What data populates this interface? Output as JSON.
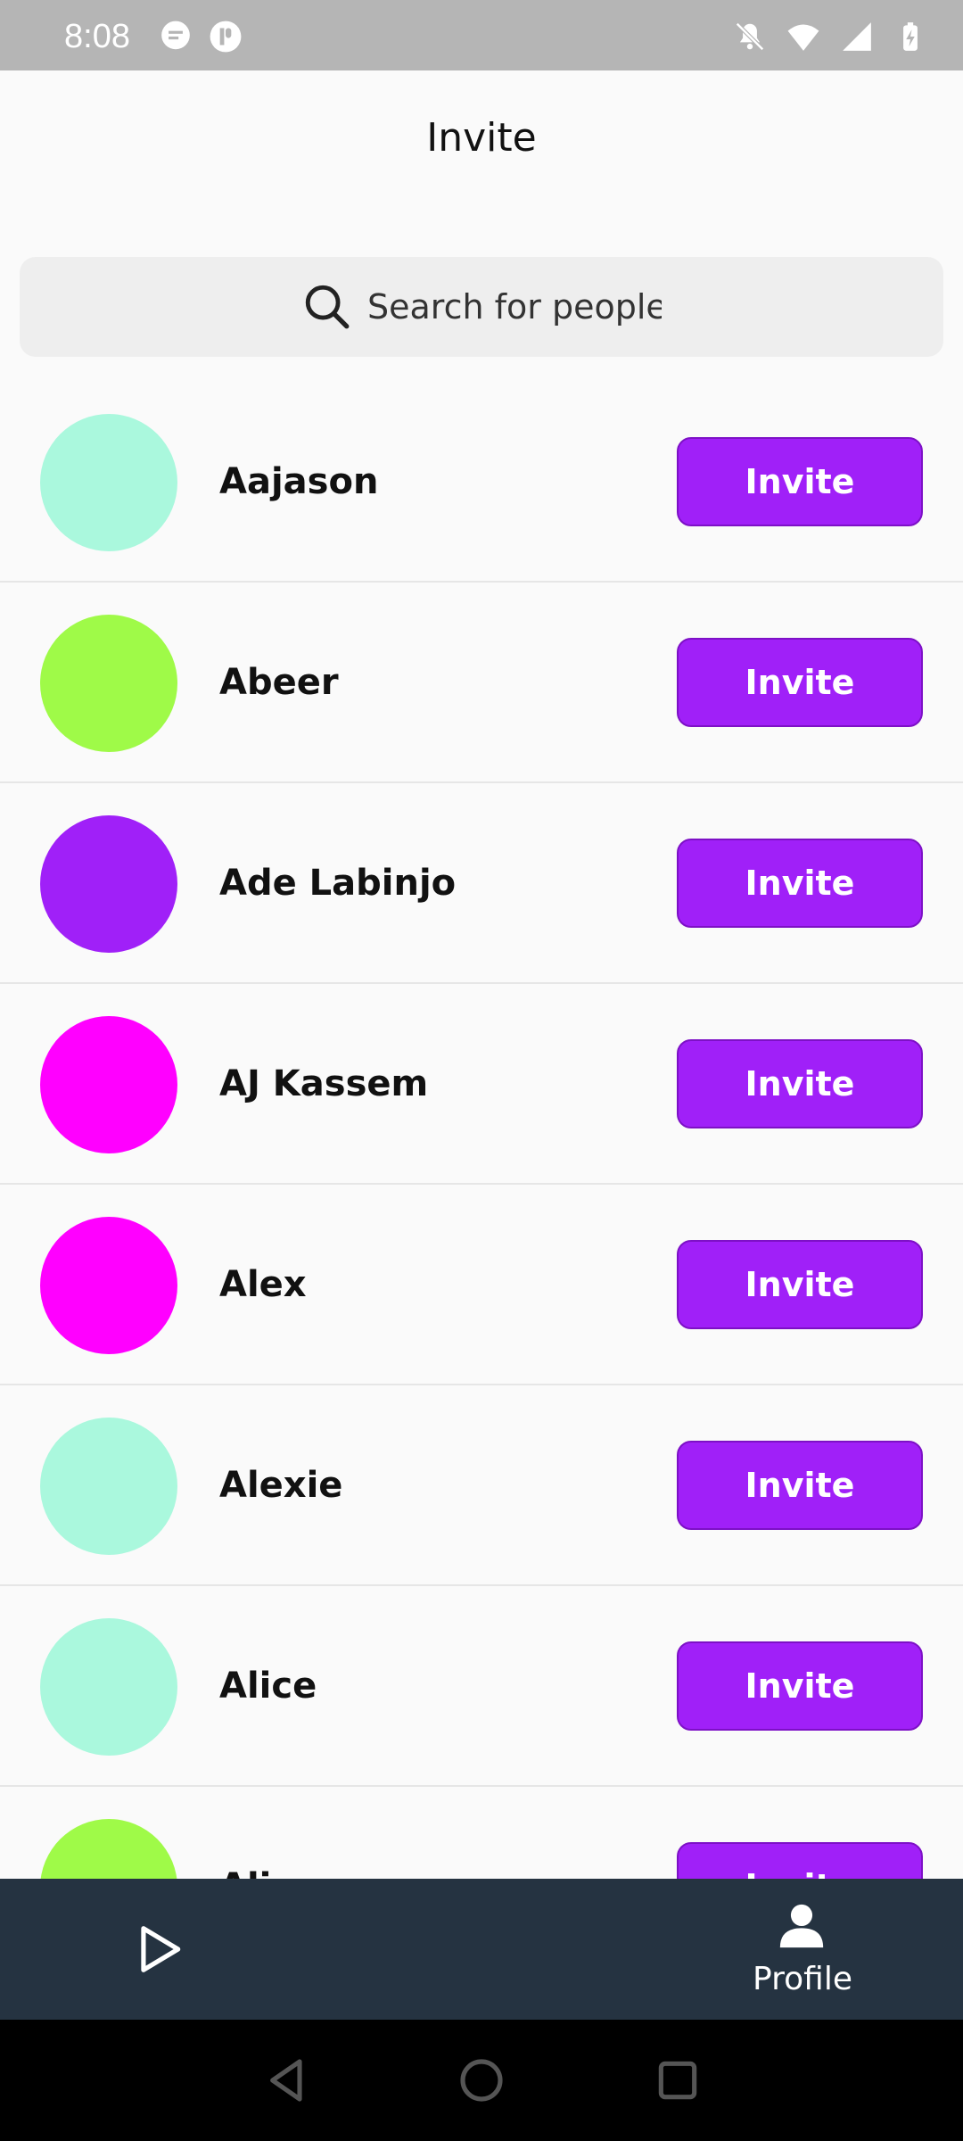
{
  "status_bar": {
    "time": "8:08"
  },
  "header": {
    "title": "Invite"
  },
  "search": {
    "placeholder": "Search for people"
  },
  "people": [
    {
      "name": "Aajason",
      "avatar_color": "#aaf8dd",
      "button": "Invite"
    },
    {
      "name": "Abeer",
      "avatar_color": "#9ffa48",
      "button": "Invite"
    },
    {
      "name": "Ade Labinjo",
      "avatar_color": "#a020f8",
      "button": "Invite"
    },
    {
      "name": "AJ Kassem",
      "avatar_color": "#ff00ff",
      "button": "Invite"
    },
    {
      "name": "Alex",
      "avatar_color": "#ff00ff",
      "button": "Invite"
    },
    {
      "name": "Alexie",
      "avatar_color": "#aaf8dd",
      "button": "Invite"
    },
    {
      "name": "Alice",
      "avatar_color": "#aaf8dd",
      "button": "Invite"
    },
    {
      "name": "Ali…",
      "avatar_color": "#9ffa48",
      "button": "Invite"
    }
  ],
  "bottom_nav": {
    "profile_label": "Profile"
  },
  "colors": {
    "accent": "#a020f8",
    "nav_background": "#253341"
  }
}
